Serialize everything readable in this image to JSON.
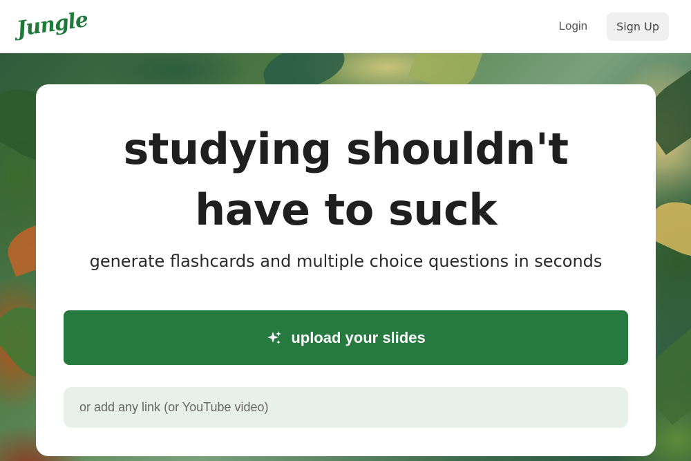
{
  "header": {
    "logo_text": "Jungle",
    "login_label": "Login",
    "signup_label": "Sign Up"
  },
  "hero": {
    "headline_line1": "studying shouldn't",
    "headline_line2": "have to suck",
    "subheadline": "generate flashcards and multiple choice questions in seconds",
    "upload_label": "upload your slides",
    "upload_icon": "sparkles-icon",
    "link_placeholder": "or add any link (or YouTube video)"
  },
  "colors": {
    "brand_green": "#267a3f",
    "input_bg": "#e8f1e9",
    "signup_bg": "#f0f0f0"
  }
}
